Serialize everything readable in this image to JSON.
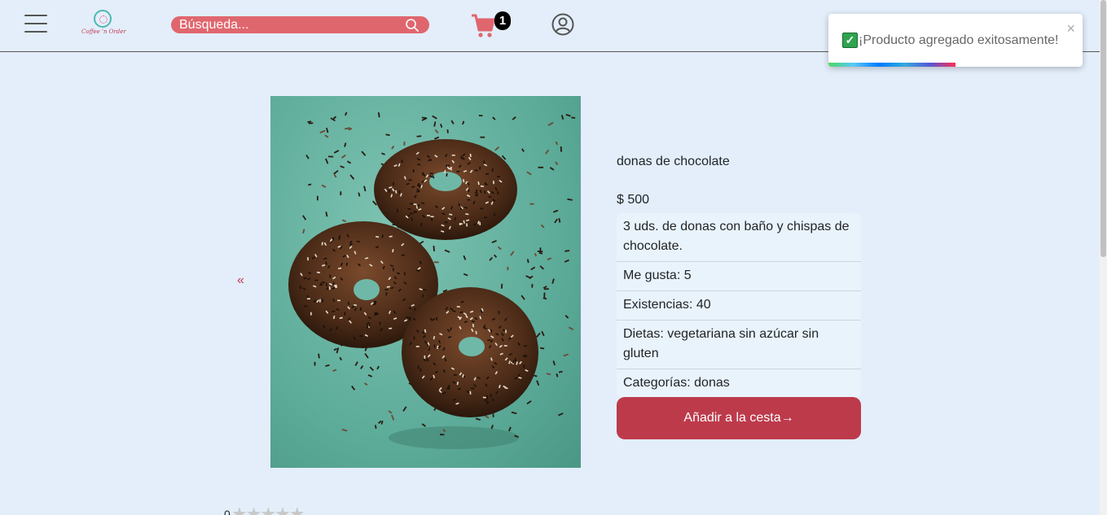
{
  "header": {
    "logo_text": "Coffee 'n Order",
    "search_placeholder": "Búsqueda...",
    "cart_count": "1"
  },
  "toast": {
    "check": "✓",
    "message": "¡Producto agregado exitosamente!",
    "close": "×",
    "progress_fraction": 0.5
  },
  "product": {
    "prev_arrow": "«",
    "name": "donas de chocolate",
    "price": "$ 500",
    "details": [
      "3 uds. de donas con baño y chispas de chocolate.",
      "Me gusta: 5",
      "Existencias: 40",
      "Dietas: vegetariana sin azúcar sin gluten",
      "Categorías: donas"
    ],
    "add_button": "Añadir a la cesta→"
  },
  "rating": {
    "value": "0",
    "stars": "★★★★★"
  },
  "colors": {
    "accent": "#bd3a4b",
    "search_bg": "#e0666e",
    "page_bg": "#e3eefa"
  },
  "icons": [
    "menu-icon",
    "search-icon",
    "cart-icon",
    "user-icon",
    "check-icon",
    "close-icon"
  ]
}
